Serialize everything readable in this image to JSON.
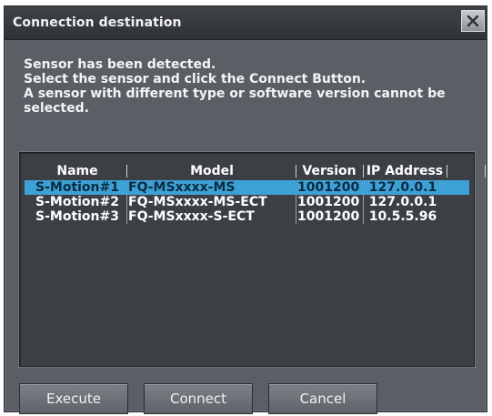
{
  "window": {
    "title": "Connection destination"
  },
  "message": {
    "line1": "Sensor has been detected.",
    "line2": "Select the sensor and click the Connect Button.",
    "line3": "A sensor with different type or software version cannot be",
    "line4": "selected."
  },
  "table": {
    "columns": {
      "name": "Name",
      "model": "Model",
      "version": "Version",
      "ip": "IP Address"
    },
    "rows": [
      {
        "name": "S-Motion#1",
        "model": "FQ-MSxxxx-MS",
        "version": "1001200",
        "ip": "127.0.0.1",
        "selected": true
      },
      {
        "name": "S-Motion#2",
        "model": "FQ-MSxxxx-MS-ECT",
        "version": "1001200",
        "ip": "127.0.0.1",
        "selected": false
      },
      {
        "name": "S-Motion#3",
        "model": "FQ-MSxxxx-S-ECT",
        "version": "1001200",
        "ip": "10.5.5.96",
        "selected": false
      }
    ]
  },
  "buttons": {
    "execute": "Execute",
    "connect": "Connect",
    "cancel": "Cancel"
  },
  "icons": {
    "close": "close-icon"
  },
  "colors": {
    "selection": "#3ea1d6",
    "window_bg": "#5a5f66",
    "table_bg": "#3c4045"
  }
}
